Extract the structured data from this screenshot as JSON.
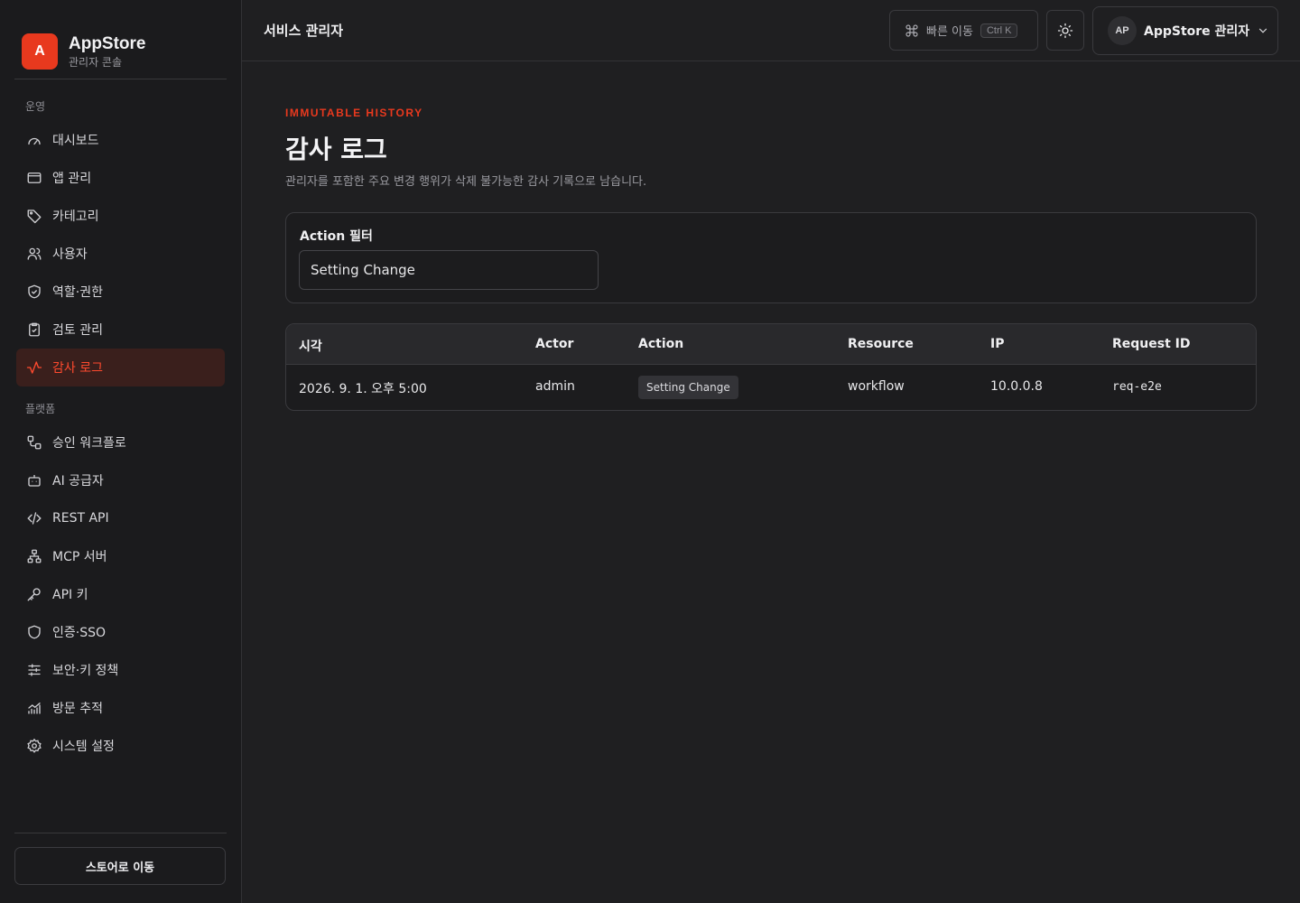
{
  "brand": {
    "logo_letter": "A",
    "name": "AppStore",
    "subtitle": "관리자 콘솔",
    "accent": "#e8391e"
  },
  "sidebar": {
    "sections": [
      {
        "label": "운영",
        "items": [
          {
            "label": "대시보드",
            "icon": "gauge-icon"
          },
          {
            "label": "앱 관리",
            "icon": "window-icon"
          },
          {
            "label": "카테고리",
            "icon": "tag-icon"
          },
          {
            "label": "사용자",
            "icon": "users-icon"
          },
          {
            "label": "역할·권한",
            "icon": "shield-check-icon"
          },
          {
            "label": "검토 관리",
            "icon": "clipboard-check-icon"
          },
          {
            "label": "감사 로그",
            "icon": "activity-icon",
            "active": true
          }
        ]
      },
      {
        "label": "플랫폼",
        "items": [
          {
            "label": "승인 워크플로",
            "icon": "workflow-icon"
          },
          {
            "label": "AI 공급자",
            "icon": "bot-icon"
          },
          {
            "label": "REST API",
            "icon": "code-icon"
          },
          {
            "label": "MCP 서버",
            "icon": "network-icon"
          },
          {
            "label": "API 키",
            "icon": "key-icon"
          },
          {
            "label": "인증·SSO",
            "icon": "shield-icon"
          },
          {
            "label": "보안·키 정책",
            "icon": "sliders-icon"
          },
          {
            "label": "방문 추적",
            "icon": "chart-icon"
          },
          {
            "label": "시스템 설정",
            "icon": "gear-icon"
          }
        ]
      }
    ],
    "store_button": "스토어로 이동"
  },
  "topbar": {
    "title": "서비스 관리자",
    "quick_nav": {
      "label": "빠른 이동",
      "shortcut": "Ctrl K"
    },
    "profile": {
      "initials": "AP",
      "name": "AppStore 관리자"
    }
  },
  "page": {
    "eyebrow": "IMMUTABLE HISTORY",
    "title": "감사 로그",
    "description": "관리자를 포함한 주요 변경 행위가 삭제 불가능한 감사 기록으로 남습니다."
  },
  "filter": {
    "label": "Action 필터",
    "value": "Setting Change"
  },
  "table": {
    "headers": [
      "시각",
      "Actor",
      "Action",
      "Resource",
      "IP",
      "Request ID"
    ],
    "rows": [
      {
        "time": "2026. 9. 1. 오후 5:00",
        "actor": "admin",
        "action": "Setting Change",
        "resource": "workflow",
        "ip": "10.0.0.8",
        "request_id": "req-e2e"
      }
    ]
  }
}
